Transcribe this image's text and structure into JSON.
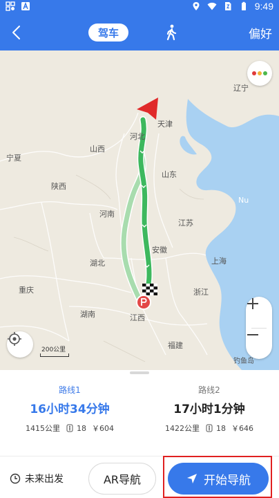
{
  "status_bar": {
    "time": "9:49"
  },
  "header": {
    "modes": [
      {
        "label": "驾车",
        "selected": true
      },
      {
        "icon": "walk-icon",
        "selected": false
      }
    ],
    "preference_label": "偏好"
  },
  "map": {
    "labels": {
      "liaoning": "辽宁",
      "tianjin": "天津",
      "hebei": "河北",
      "shanxi": "山西",
      "ningxia": "宁夏",
      "shandong": "山东",
      "shaanxi": "陕西",
      "henan": "河南",
      "jiangsu": "江苏",
      "anhui": "安徽",
      "hubei": "湖北",
      "shanghai": "上海",
      "chongqing": "重庆",
      "zhejiang": "浙江",
      "hunan": "湖南",
      "jiangxi": "江西",
      "fujian": "福建",
      "sea": "Nu",
      "diaoyu": "钓鱼岛"
    },
    "scale_label": "200公里",
    "colors": {
      "land": "#eeeae0",
      "sea": "#a9d1f2",
      "route_primary": "#3db85e",
      "route_alt": "#a8dcae",
      "start_marker": "#e02a2a"
    }
  },
  "routes": [
    {
      "name": "路线1",
      "duration": "16小时34分钟",
      "distance": "1415公里",
      "lights": "18",
      "toll": "￥604",
      "selected": true
    },
    {
      "name": "路线2",
      "duration": "17小时1分钟",
      "distance": "1422公里",
      "lights": "18",
      "toll": "￥646",
      "selected": false
    }
  ],
  "actions": {
    "future_departure": "未来出发",
    "ar_navigation": "AR导航",
    "start_navigation": "开始导航"
  },
  "accent_color": "#3779ea"
}
